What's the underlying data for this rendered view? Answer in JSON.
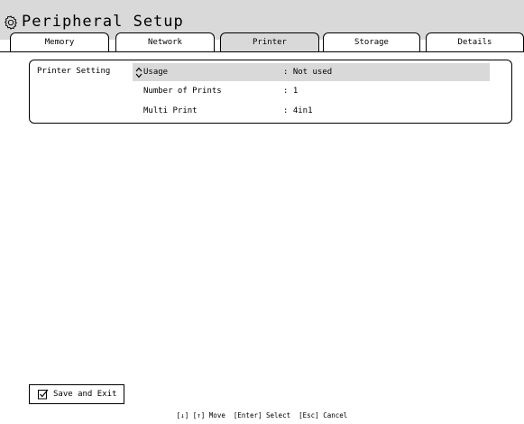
{
  "window": {
    "title": "Peripheral Setup",
    "icon": "gear-icon"
  },
  "tabs": [
    {
      "label": "Memory",
      "active": false
    },
    {
      "label": "Network",
      "active": false
    },
    {
      "label": "Printer",
      "active": true
    },
    {
      "label": "Storage",
      "active": false
    },
    {
      "label": "Details",
      "active": false
    }
  ],
  "printer": {
    "group_label": "Printer Setting",
    "rows": [
      {
        "label": "Usage",
        "value": ": Not used",
        "selected": true,
        "icon": "up-down-arrows-icon"
      },
      {
        "label": "Number of Prints",
        "value": ": 1",
        "selected": false
      },
      {
        "label": "Multi Print",
        "value": ": 4in1",
        "selected": false
      }
    ]
  },
  "footer": {
    "save_label": "Save and Exit",
    "save_icon": "checkbox-icon",
    "hint": "[↓] [↑] Move  [Enter] Select  [Esc] Cancel"
  },
  "colors": {
    "highlight": "#d9d9d9",
    "border": "#000000",
    "background": "#ffffff"
  }
}
